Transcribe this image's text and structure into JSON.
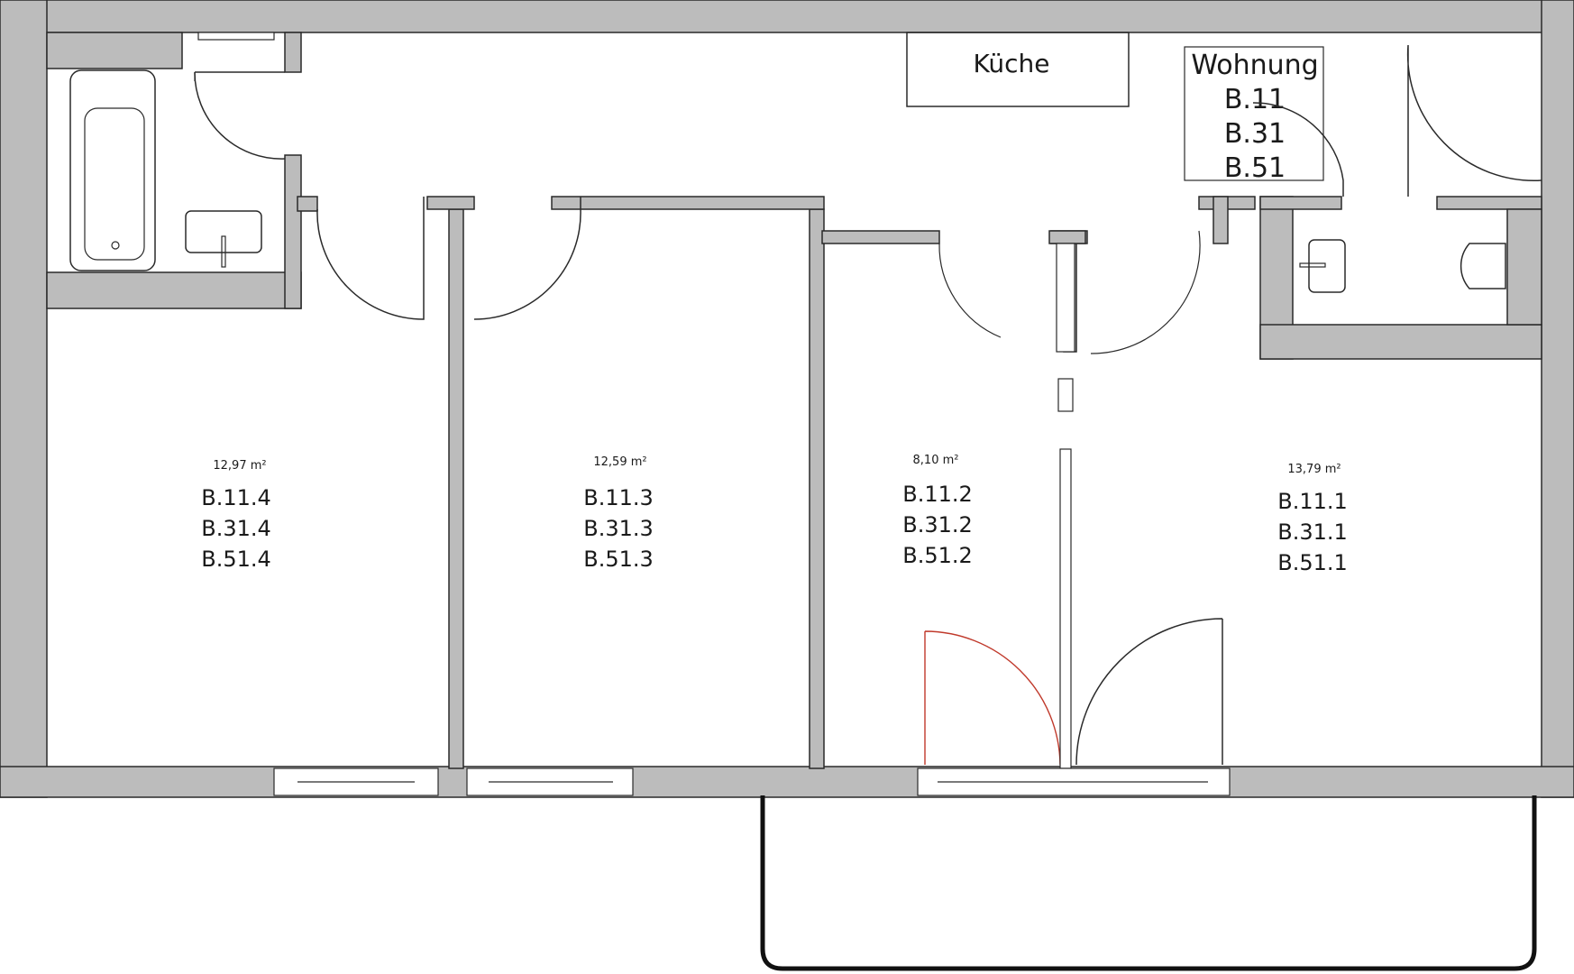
{
  "kitchen_label": "Küche",
  "apartment": {
    "title": "Wohnung",
    "units": [
      "B.11",
      "B.31",
      "B.51"
    ]
  },
  "rooms": [
    {
      "area": "12,97 m²",
      "ids": [
        "B.11.4",
        "B.31.4",
        "B.51.4"
      ]
    },
    {
      "area": "12,59 m²",
      "ids": [
        "B.11.3",
        "B.31.3",
        "B.51.3"
      ]
    },
    {
      "area": "8,10 m²",
      "ids": [
        "B.11.2",
        "B.31.2",
        "B.51.2"
      ]
    },
    {
      "area": "13,79 m²",
      "ids": [
        "B.11.1",
        "B.31.1",
        "B.51.1"
      ]
    }
  ],
  "colors": {
    "wall": "#bcbcbc",
    "line": "#2a2a2a",
    "highlight_door": "#c0392b"
  }
}
